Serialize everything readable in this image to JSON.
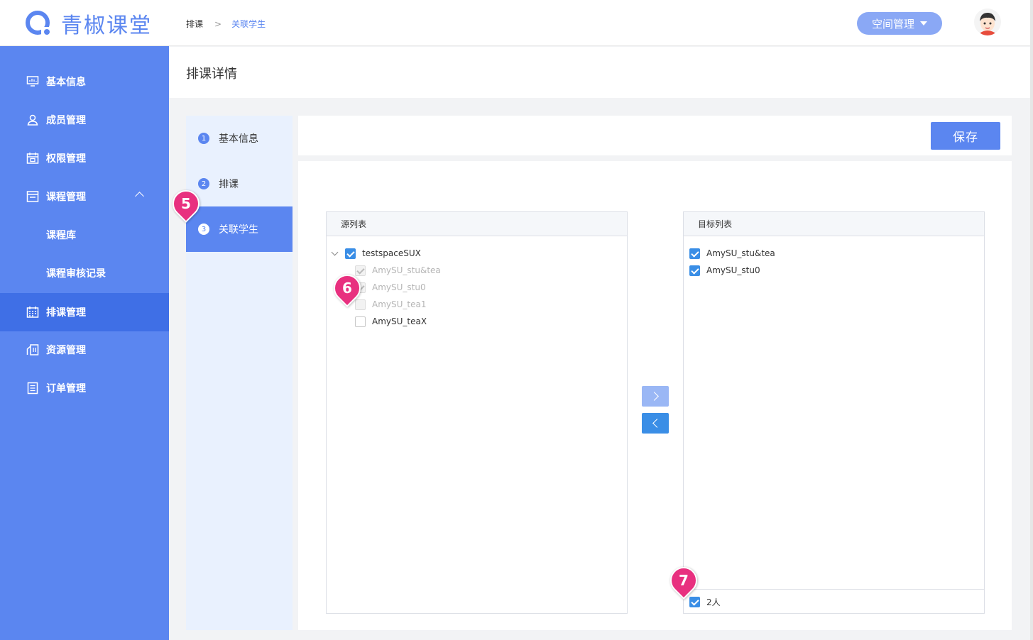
{
  "header": {
    "logo_text": "青椒课堂",
    "breadcrumb": [
      "排课",
      "关联学生"
    ],
    "breadcrumb_sep": ">",
    "space_button": "空间管理"
  },
  "sidebar": {
    "items": [
      {
        "label": "基本信息",
        "icon": "monitor-icon"
      },
      {
        "label": "成员管理",
        "icon": "user-icon"
      },
      {
        "label": "权限管理",
        "icon": "calendar-check-icon"
      },
      {
        "label": "课程管理",
        "icon": "course-icon",
        "expanded": true
      },
      {
        "label": "课程库",
        "sub": true
      },
      {
        "label": "课程审核记录",
        "sub": true
      },
      {
        "label": "排课管理",
        "icon": "calendar-grid-icon",
        "active": true
      },
      {
        "label": "资源管理",
        "icon": "resource-icon"
      },
      {
        "label": "订单管理",
        "icon": "order-icon"
      }
    ]
  },
  "page": {
    "title": "排课详情",
    "save_label": "保存"
  },
  "steps": [
    {
      "num": "1",
      "label": "基本信息"
    },
    {
      "num": "2",
      "label": "排课"
    },
    {
      "num": "3",
      "label": "关联学生",
      "active": true
    }
  ],
  "source": {
    "title": "源列表",
    "group": "testspaceSUX",
    "items": [
      {
        "label": "AmySU_stu&tea",
        "checked": true,
        "disabled": true
      },
      {
        "label": "AmySU_stu0",
        "checked": true,
        "disabled": true
      },
      {
        "label": "AmySU_tea1",
        "checked": false,
        "disabled": true
      },
      {
        "label": "AmySU_teaX",
        "checked": false,
        "disabled": false
      }
    ]
  },
  "target": {
    "title": "目标列表",
    "items": [
      {
        "label": "AmySU_stu&tea",
        "checked": true
      },
      {
        "label": "AmySU_stu0",
        "checked": true
      }
    ],
    "footer_count": "2人"
  },
  "annotations": [
    "5",
    "6",
    "7"
  ],
  "colors": {
    "primary": "#5b86f0",
    "primary_dark": "#3f6fe6",
    "checkbox_blue": "#3a8ee6",
    "pin_pink": "#e8307f"
  }
}
